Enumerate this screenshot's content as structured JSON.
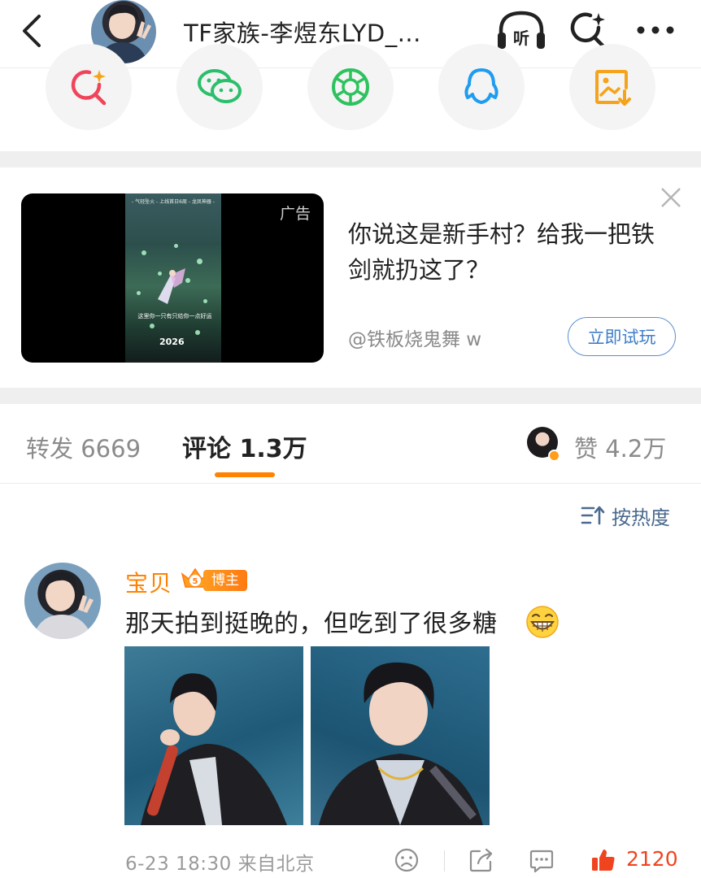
{
  "header": {
    "title": "TF家族-李煜东LYD_...",
    "listen_label": "听"
  },
  "share": {
    "items": [
      {
        "icon": "search-sparkle-icon",
        "color": "#f0445a"
      },
      {
        "icon": "wechat-icon",
        "color": "#2bbf6b"
      },
      {
        "icon": "moments-icon",
        "color": "#2ec25f"
      },
      {
        "icon": "qq-icon",
        "color": "#1e9cf0"
      },
      {
        "icon": "save-image-icon",
        "color": "#f5a31a"
      }
    ]
  },
  "ad": {
    "label": "广告",
    "text": "你说这是新手村？给我一把铁剑就扔这了？",
    "source": "@铁板烧鬼舞 w",
    "button": "立即试玩",
    "game_banner": "- 气轻坠火 - 上线首日6周 - 龙凤神器 -",
    "game_caption": "这里你一只有只给你一点好运",
    "game_year": "2026"
  },
  "tabs": {
    "repost": "转发 6669",
    "comment": "评论 1.3万",
    "like": "赞 4.2万"
  },
  "sort": {
    "label": "按热度"
  },
  "comment": {
    "name": "宝贝",
    "crown_level": "5",
    "tag": "博主",
    "text": "那天拍到挺晚的，但吃到了很多糖",
    "meta": "6-23 18:30 来自北京",
    "like_count": "2120"
  },
  "colors": {
    "accent": "#ff8200",
    "link": "#4a6a8f",
    "like": "#f0441e"
  }
}
